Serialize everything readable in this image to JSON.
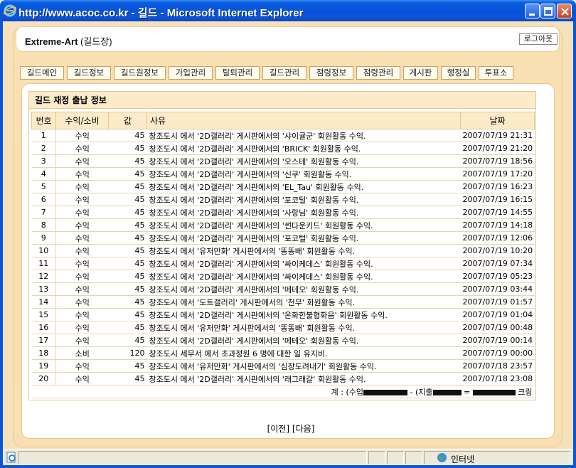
{
  "window": {
    "title": "http://www.acoc.co.kr - 길드 - Microsoft Internet Explorer"
  },
  "header": {
    "guild_name": "Extreme-Art",
    "role": " (길드장)",
    "logout_label": "로그아웃"
  },
  "tabs": [
    "길드메인",
    "길드정보",
    "길드원정보",
    "가입관리",
    "탈퇴관리",
    "길드관리",
    "점령정보",
    "점령관리",
    "게시판",
    "행정실",
    "투표소"
  ],
  "ledger": {
    "title": "길드 재정 출납 정보",
    "columns": [
      "번호",
      "수익/소비",
      "값",
      "사유",
      "날짜"
    ],
    "rows": [
      {
        "no": "1",
        "type": "수익",
        "value": "45",
        "reason": "창조도시 에서 '2D갤러리' 게시판에서의 '샤이귤군' 회원활동 수익.",
        "date": "2007/07/19 21:31"
      },
      {
        "no": "2",
        "type": "수익",
        "value": "45",
        "reason": "창조도시 에서 '2D갤러리' 게시판에서의 'BRICK' 회원활동 수익.",
        "date": "2007/07/19 21:20"
      },
      {
        "no": "3",
        "type": "수익",
        "value": "45",
        "reason": "창조도시 에서 '2D갤러리' 게시판에서의 '오스테' 회원활동 수익.",
        "date": "2007/07/19 18:56"
      },
      {
        "no": "4",
        "type": "수익",
        "value": "45",
        "reason": "창조도시 에서 '2D갤러리' 게시판에서의 '신쿠' 회원활동 수익.",
        "date": "2007/07/19 17:20"
      },
      {
        "no": "5",
        "type": "수익",
        "value": "45",
        "reason": "창조도시 에서 '2D갤러리' 게시판에서의 'EL_Tau' 회원활동 수익.",
        "date": "2007/07/19 16:23"
      },
      {
        "no": "6",
        "type": "수익",
        "value": "45",
        "reason": "창조도시 에서 '2D갤러리' 게시판에서의 '포코털' 회원활동 수익.",
        "date": "2007/07/19 16:15"
      },
      {
        "no": "7",
        "type": "수익",
        "value": "45",
        "reason": "창조도시 에서 '2D갤러리' 게시판에서의 '사랑님' 회원활동 수익.",
        "date": "2007/07/19 14:55"
      },
      {
        "no": "8",
        "type": "수익",
        "value": "45",
        "reason": "창조도시 에서 '2D갤러리' 게시판에서의 '썬다운키드' 회원활동 수익.",
        "date": "2007/07/19 14:18"
      },
      {
        "no": "9",
        "type": "수익",
        "value": "45",
        "reason": "창조도시 에서 '2D갤러리' 게시판에서의 '포코털' 회원활동 수익.",
        "date": "2007/07/19 12:06"
      },
      {
        "no": "10",
        "type": "수익",
        "value": "45",
        "reason": "창조도시 에서 '유저만화' 게시판에서의 '똥똥배' 회원활동 수익.",
        "date": "2007/07/19 10:20"
      },
      {
        "no": "11",
        "type": "수익",
        "value": "45",
        "reason": "창조도시 에서 '2D갤러리' 게시판에서의 '싸이케데스' 회원활동 수익.",
        "date": "2007/07/19 07:34"
      },
      {
        "no": "12",
        "type": "수익",
        "value": "45",
        "reason": "창조도시 에서 '2D갤러리' 게시판에서의 '싸이케데스' 회원활동 수익.",
        "date": "2007/07/19 05:23"
      },
      {
        "no": "13",
        "type": "수익",
        "value": "45",
        "reason": "창조도시 에서 '2D갤러리' 게시판에서의 '메테오' 회원활동 수익.",
        "date": "2007/07/19 03:44"
      },
      {
        "no": "14",
        "type": "수익",
        "value": "45",
        "reason": "창조도시 에서 '도트갤러리' 게시판에서의 '천무' 회원활동 수익.",
        "date": "2007/07/19 01:57"
      },
      {
        "no": "15",
        "type": "수익",
        "value": "45",
        "reason": "창조도시 에서 '2D갤러리' 게시판에서의 '온화한불협화음' 회원활동 수익.",
        "date": "2007/07/19 01:04"
      },
      {
        "no": "16",
        "type": "수익",
        "value": "45",
        "reason": "창조도시 에서 '유저만화' 게시판에서의 '똥똥배' 회원활동 수익.",
        "date": "2007/07/19 00:48"
      },
      {
        "no": "17",
        "type": "수익",
        "value": "45",
        "reason": "창조도시 에서 '2D갤러리' 게시판에서의 '메테오' 회원활동 수익.",
        "date": "2007/07/19 00:14"
      },
      {
        "no": "18",
        "type": "소비",
        "value": "120",
        "reason": "창조도시 세무서 에서 초과정원 6 명에 대한 일 유지비.",
        "date": "2007/07/19 00:00"
      },
      {
        "no": "19",
        "type": "수익",
        "value": "45",
        "reason": "창조도시 에서 '유저만화' 게시판에서의 '심장도려내기' 회원활동 수익.",
        "date": "2007/07/18 23:57"
      },
      {
        "no": "20",
        "type": "수익",
        "value": "45",
        "reason": "창조도시 에서 '2D갤러리' 게시판에서의 '래그래갈' 회원활동 수익.",
        "date": "2007/07/18 23:08"
      }
    ],
    "total": {
      "prefix": "계 : (수입",
      "middle": " - (지출",
      "equals": " = ",
      "suffix": " 크링"
    }
  },
  "pager": {
    "prev": "[이전]",
    "next": "[다음]"
  },
  "statusbar": {
    "zone": "인터넷"
  }
}
